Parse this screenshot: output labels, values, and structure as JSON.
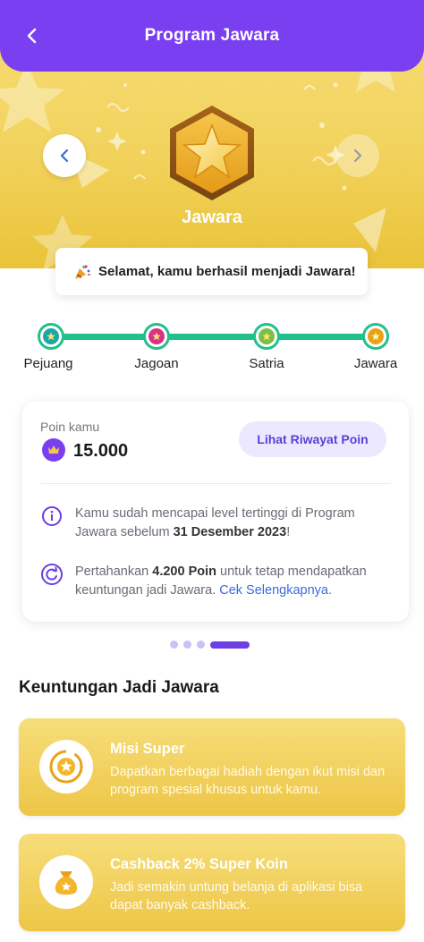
{
  "header": {
    "title": "Program Jawara",
    "back_icon": "arrow-left-icon"
  },
  "hero": {
    "level_name": "Jawara",
    "badge_icon": "gold-star-hexagon-badge-icon",
    "congrats_text": "Selamat, kamu berhasil menjadi Jawara!",
    "congrats_icon": "party-popper-icon"
  },
  "levels": [
    {
      "label": "Pejuang",
      "color": "#1ea7a5"
    },
    {
      "label": "Jagoan",
      "color": "#d63384"
    },
    {
      "label": "Satria",
      "color": "#7bc043"
    },
    {
      "label": "Jawara",
      "color": "#e8a21a"
    }
  ],
  "poin": {
    "label": "Poin kamu",
    "value": "15.000",
    "history_button": "Lihat Riwayat Poin",
    "info1_pre": "Kamu sudah mencapai level tertinggi di Program Jawara sebelum ",
    "info1_bold": "31 Desember 2023",
    "info1_post": "!",
    "info2_pre": "Pertahankan ",
    "info2_bold": "4.200 Poin",
    "info2_mid": " untuk tetap mendapatkan keuntungan jadi Jawara. ",
    "info2_link": "Cek Selengkapnya",
    "info2_post": "."
  },
  "carousel": {
    "count": 4,
    "active_index": 3
  },
  "benefits_section": {
    "title": "Keuntungan Jadi Jawara",
    "items": [
      {
        "title": "Misi Super",
        "desc": "Dapatkan berbagai hadiah dengan ikut misi dan program spesial khusus untuk kamu.",
        "icon": "mission-star-icon"
      },
      {
        "title": "Cashback 2% Super Koin",
        "desc": "Jadi semakin untung belanja di aplikasi bisa dapat banyak cashback.",
        "icon": "coin-bag-icon"
      }
    ]
  },
  "colors": {
    "primary": "#7b3ff2",
    "progress": "#22c08a",
    "gold": "#f2d35e"
  }
}
